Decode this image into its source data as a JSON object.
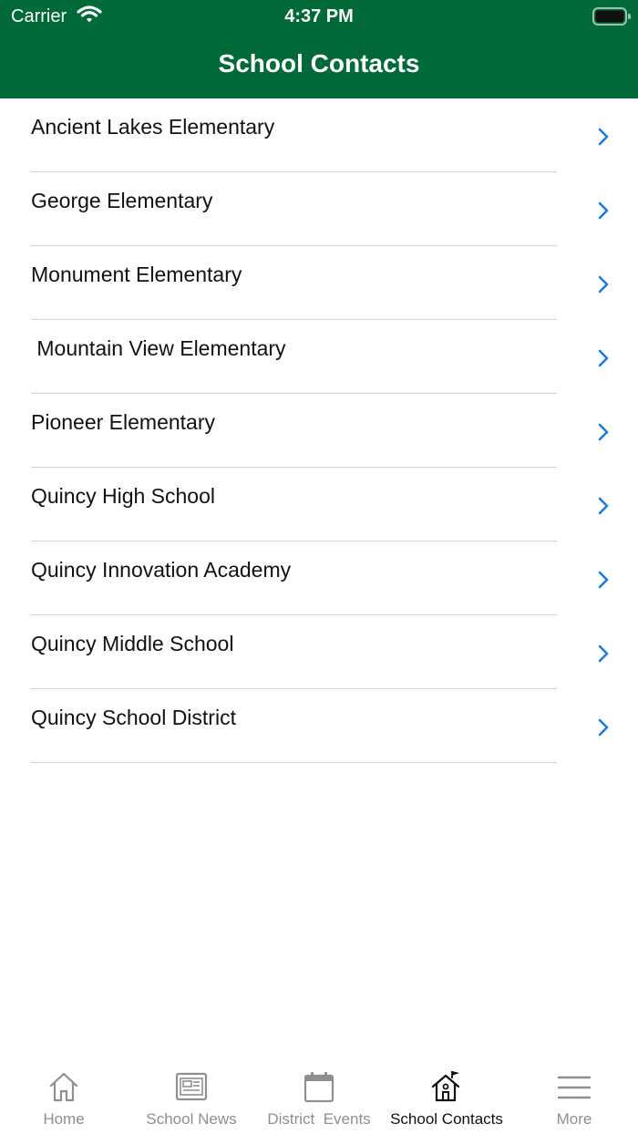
{
  "status_bar": {
    "carrier": "Carrier",
    "time": "4:37 PM"
  },
  "header": {
    "title": "School Contacts",
    "background_color": "#016a38"
  },
  "schools": [
    {
      "label": "Ancient Lakes Elementary"
    },
    {
      "label": "George Elementary"
    },
    {
      "label": "Monument Elementary"
    },
    {
      "label": " Mountain View Elementary"
    },
    {
      "label": "Pioneer Elementary"
    },
    {
      "label": "Quincy High School"
    },
    {
      "label": "Quincy Innovation Academy"
    },
    {
      "label": "Quincy Middle School"
    },
    {
      "label": "Quincy School District"
    }
  ],
  "chevron_color": "#1a7be0",
  "tabs": [
    {
      "label": "Home",
      "icon": "home-icon",
      "active": false
    },
    {
      "label": "School News",
      "icon": "newspaper-icon",
      "active": false
    },
    {
      "label": "District  Events",
      "icon": "calendar-icon",
      "active": false
    },
    {
      "label": "School Contacts",
      "icon": "school-icon",
      "active": true
    },
    {
      "label": "More",
      "icon": "menu-icon",
      "active": false
    }
  ]
}
